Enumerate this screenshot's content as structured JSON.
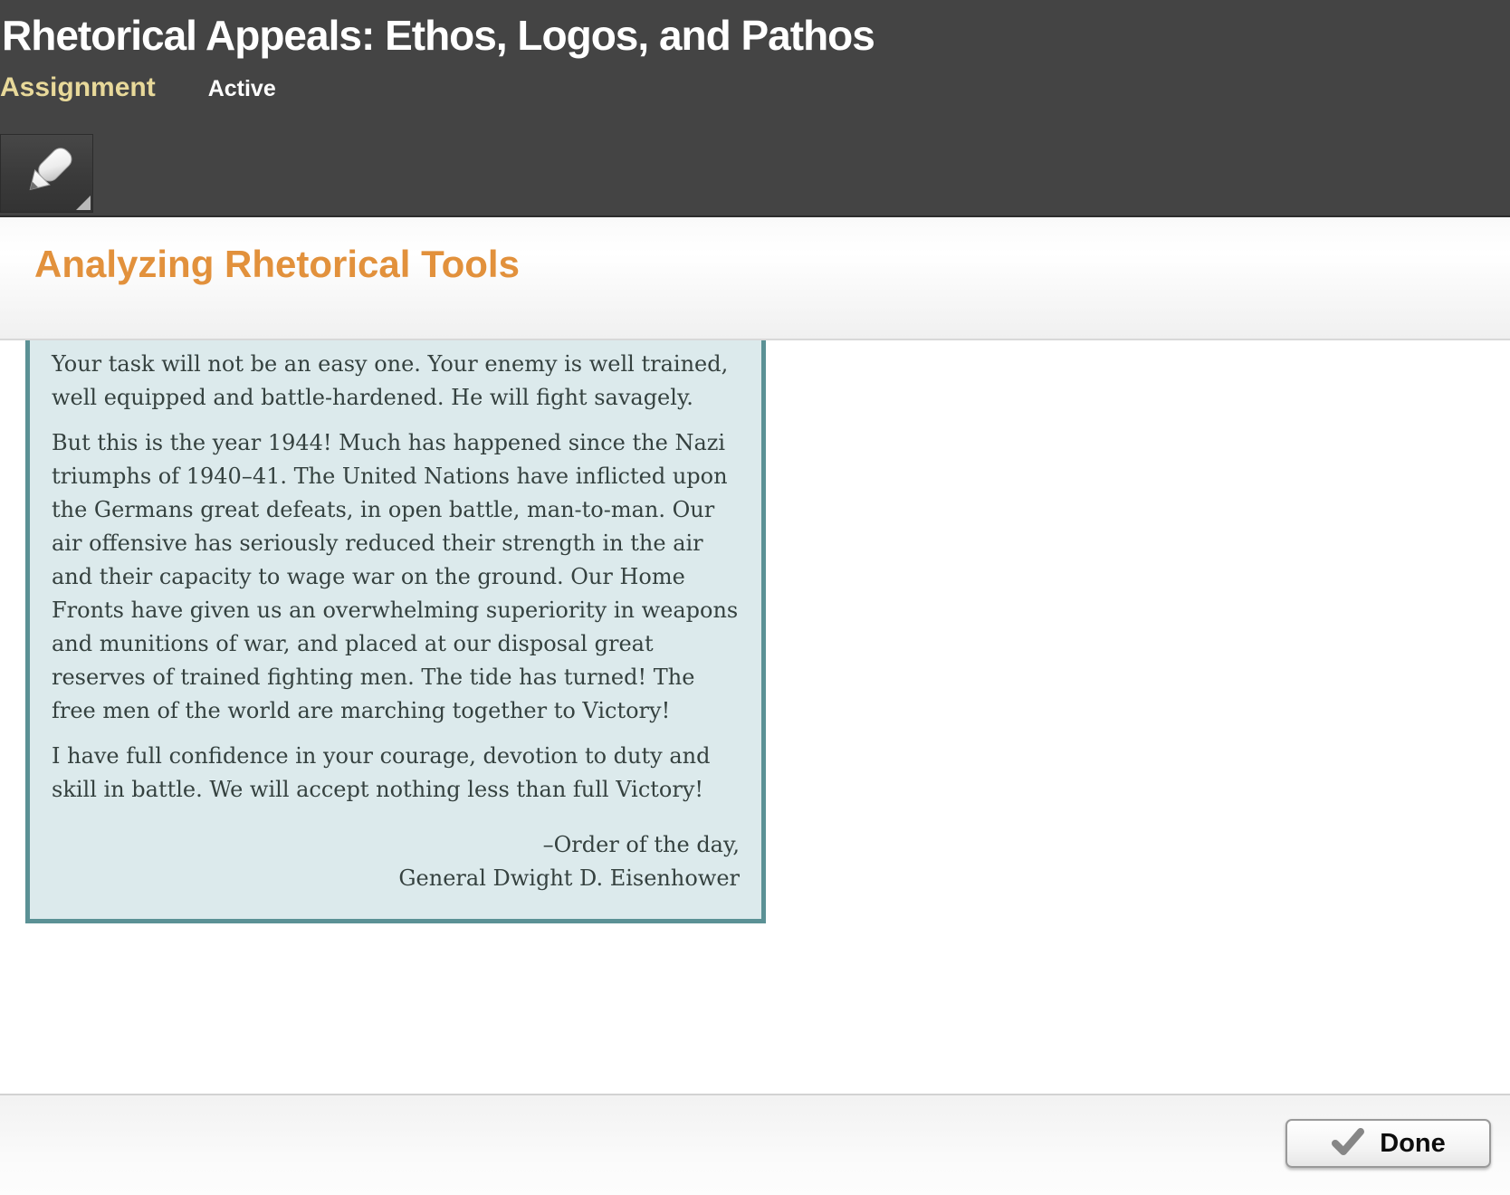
{
  "header": {
    "title": "Rhetorical Appeals: Ethos, Logos, and Pathos",
    "type_label": "Assignment",
    "status_label": "Active",
    "colors": {
      "background": "#444444",
      "type_label": "#e8d99a",
      "title": "#ffffff"
    }
  },
  "toolbar": {
    "highlighter_tool_name": "highlighter-pen-tool"
  },
  "main": {
    "heading": "Analyzing Rhetorical Tools",
    "heading_color": "#e2913c"
  },
  "quote": {
    "paragraphs": [
      "Your task will not be an easy one. Your enemy is well trained, well equipped and battle-hardened. He will fight savagely.",
      "But this is the year 1944! Much has happened since the Nazi triumphs of 1940–41. The United Nations have inflicted upon the Germans great defeats, in open battle, man-to-man. Our air offensive has seriously reduced their strength in the air and their capacity to wage war on the ground. Our Home Fronts have given us an overwhelming superiority in weapons and munitions of war, and placed at our disposal great reserves of trained fighting men. The tide has turned! The free men of the world are marching together to Victory!",
      "I have full confidence in your courage, devotion to duty and skill in battle. We will accept nothing less than full Victory!"
    ],
    "attribution_line1": "–Order of the day,",
    "attribution_line2": "General Dwight D. Eisenhower",
    "colors": {
      "background": "#dceaec",
      "border": "#5b9195",
      "text": "#35413f"
    }
  },
  "footer": {
    "done_label": "Done"
  }
}
